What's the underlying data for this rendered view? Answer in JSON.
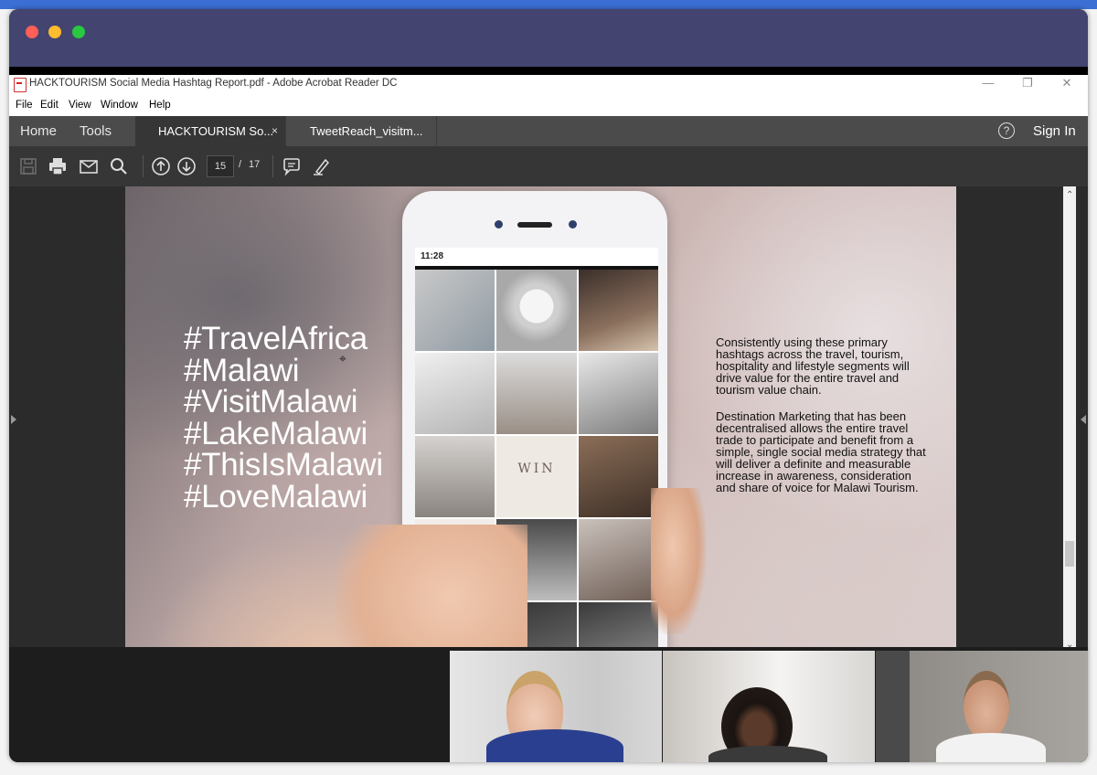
{
  "acrobat": {
    "window_title": "HACKTOURISM Social Media Hashtag Report.pdf - Adobe Acrobat Reader DC",
    "menu": [
      "File",
      "Edit",
      "View",
      "Window",
      "Help"
    ],
    "nav": {
      "home": "Home",
      "tools": "Tools"
    },
    "tabs": [
      {
        "label": "HACKTOURISM So...",
        "active": true,
        "close": "×"
      },
      {
        "label": "TweetReach_visitm...",
        "active": false
      }
    ],
    "help": "?",
    "sign_in": "Sign In",
    "toolbar": {
      "icons": [
        "save-icon",
        "print-icon",
        "email-icon",
        "search-icon",
        "page-up-icon",
        "page-down-icon",
        "comment-icon",
        "pen-icon"
      ],
      "current_page": "15",
      "separator": "/",
      "total_pages": "17"
    }
  },
  "slide": {
    "phone_time": "11:28",
    "grid_text": "WIN",
    "hashtags": [
      "#TravelAfrica",
      "#Malawi",
      "#VisitMalawi",
      "#LakeMalawi",
      "#ThisIsMalawi",
      "#LoveMalawi"
    ],
    "paragraph_1": "Consistently using these primary hashtags across the travel, tourism, hospitality and  lifestyle segments will drive value for the entire travel and tourism value chain.",
    "paragraph_2": "Destination Marketing that has been decentralised allows the entire travel trade to participate and benefit from a simple, single social media strategy that will deliver a definite and measurable increase in awareness, consideration and share of voice for Malawi Tourism."
  },
  "colors": {
    "zoom_titlebar": "#444470",
    "acrobat_tabbar": "#4b4b4b",
    "acrobat_toolbar": "#363636"
  },
  "video_participants": 3
}
